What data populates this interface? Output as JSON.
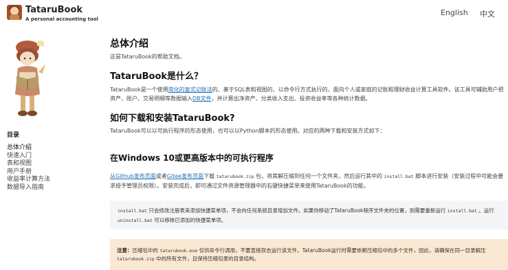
{
  "header": {
    "title": "TataruBook",
    "subtitle": "A personal accounting tool",
    "lang_en": "English",
    "lang_zh": "中文",
    "logo_icon": "mascot-logo-icon"
  },
  "sidebar": {
    "toc_title": "目录",
    "items": [
      {
        "label": "总体介绍"
      },
      {
        "label": "快速入门"
      },
      {
        "label": "表和视图"
      },
      {
        "label": "用户手册"
      },
      {
        "label": "收益率计算方法"
      },
      {
        "label": "数据导入指南"
      }
    ]
  },
  "main": {
    "h1": "总体介绍",
    "intro": "这是TataruBook的帮助文档。",
    "h2_what": "TataruBook是什么？",
    "what_p1": "TataruBook是一个使用",
    "what_link1": "简化的复式记账法",
    "what_p2": "的、基于SQL表和视图的、以命令行方式执行的、面向个人或家庭的记账和理财收益计算工具软件。该工具可辅助用户把资产、账户、交易明细等数据输入",
    "what_link2": "DB文件",
    "what_p3": "，并计算出净资产、分类收入支出、投资收益率等各种统计数据。",
    "h2_how": "如何下载和安装TataruBook?",
    "how_p": "TataruBook可以以可执行程序的形态使用，也可以以Python脚本的形态使用。对应的两种下载和安装方式如下：",
    "h3_win": "在Windows 10或更高版本中的可执行程序",
    "win_link1": "从Github发布页面",
    "win_p1": "或者",
    "win_link2": "Gitee发布页面",
    "win_p2": "下载 ",
    "win_code1": "tatarubook.zip",
    "win_p3": " 包，将其解压缩到任何一个文件夹，然后运行其中的 ",
    "win_code2": "install.bat",
    "win_p4": " 脚本进行安装（安装过程中可能会要求授予管理员权限）。安装完成后，即可通过文件资源管理器中的右键快捷菜单来使用TataruBook的功能。",
    "codebox": {
      "code1": "install.bat",
      "t1": " 只会修改注册表来添加快捷菜单项，不会向任何系统目录增加文件。如果你移动了TataruBook程序文件夹的位置，则需要重新运行 ",
      "code2": "install.bat",
      "t2": " 。运行 ",
      "code3": "uninstall.bat",
      "t3": " 可以移除已添加的快捷菜单项。"
    },
    "note": {
      "label": "注意：",
      "t1": "压缩包中的 ",
      "code1": "tatarubook.exe",
      "t2": " 仅供命令行调用，不要直接双击运行该文件。TataruBook运行时需要依赖压缩包中的多个文件，因此，请确保在同一目录解压 ",
      "code2": "tatarubook.zip",
      "t3": " 中的所有文件，且保持压缩包里的目录结构。"
    }
  },
  "colors": {
    "link": "#1f6fb5",
    "note_bg": "#fbe8d3",
    "code_bg": "#f4f5f6"
  }
}
